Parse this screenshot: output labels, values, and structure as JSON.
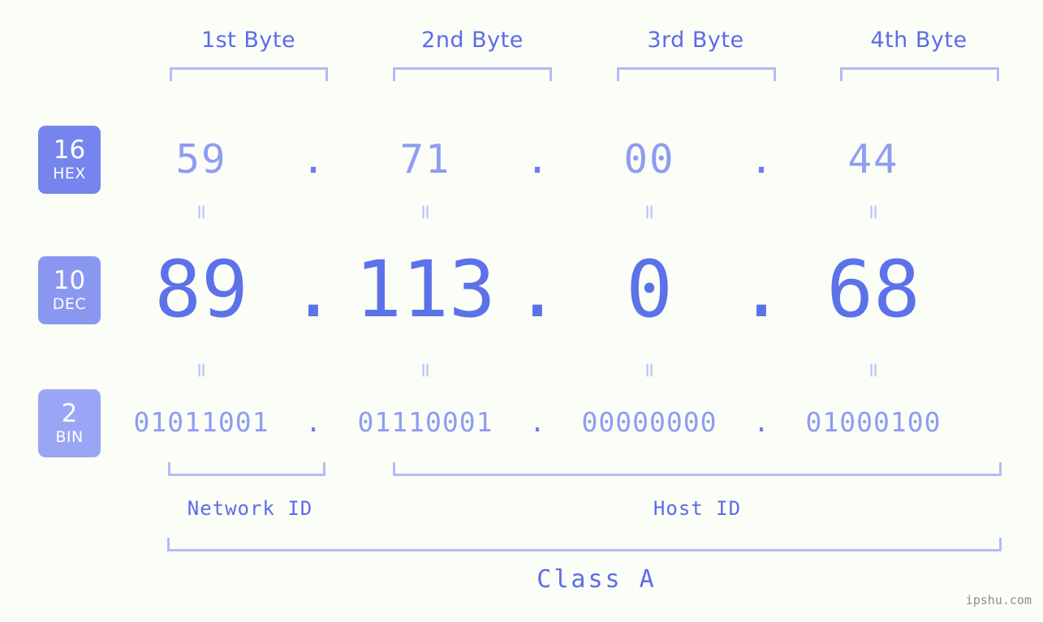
{
  "meta": {
    "background": "#fbfdf7",
    "primary_blue": "#5b6ce8",
    "light_blue": "#8e9cf2",
    "bracket_blue": "#b2bcf7",
    "watermark": "ipshu.com"
  },
  "byte_headers": [
    {
      "label": "1st Byte"
    },
    {
      "label": "2nd Byte"
    },
    {
      "label": "3rd Byte"
    },
    {
      "label": "4th Byte"
    }
  ],
  "bases": [
    {
      "num": "16",
      "name": "HEX",
      "color": "#7685ee"
    },
    {
      "num": "10",
      "name": "DEC",
      "color": "#8a97f1"
    },
    {
      "num": "2",
      "name": "BIN",
      "color": "#9aa6f5"
    }
  ],
  "rows": {
    "hex": {
      "values": [
        "59",
        "71",
        "00",
        "44"
      ],
      "separator": "."
    },
    "dec": {
      "values": [
        "89",
        "113",
        "0",
        "68"
      ],
      "separator": "."
    },
    "bin": {
      "values": [
        "01011001",
        "01110001",
        "00000000",
        "01000100"
      ],
      "separator": "."
    }
  },
  "equals_glyph": "=",
  "sections": {
    "network_id": {
      "label": "Network ID"
    },
    "host_id": {
      "label": "Host ID"
    },
    "class": {
      "label": "Class A"
    }
  },
  "chart_data": {
    "type": "table",
    "title": "IP address 89.113.0.68 byte breakdown",
    "ip_dotted_decimal": "89.113.0.68",
    "ip_hex": "59.71.00.44",
    "ip_binary": "01011001.01110001.00000000.01000100",
    "ip_class": "Class A",
    "columns": [
      "1st Byte",
      "2nd Byte",
      "3rd Byte",
      "4th Byte"
    ],
    "rows": [
      {
        "base": 16,
        "name": "HEX",
        "values": [
          "59",
          "71",
          "00",
          "44"
        ]
      },
      {
        "base": 10,
        "name": "DEC",
        "values": [
          "89",
          "113",
          "0",
          "68"
        ]
      },
      {
        "base": 2,
        "name": "BIN",
        "values": [
          "01011001",
          "01110001",
          "00000000",
          "01000100"
        ]
      }
    ],
    "network_id_bytes": [
      "1st Byte"
    ],
    "host_id_bytes": [
      "2nd Byte",
      "3rd Byte",
      "4th Byte"
    ]
  }
}
